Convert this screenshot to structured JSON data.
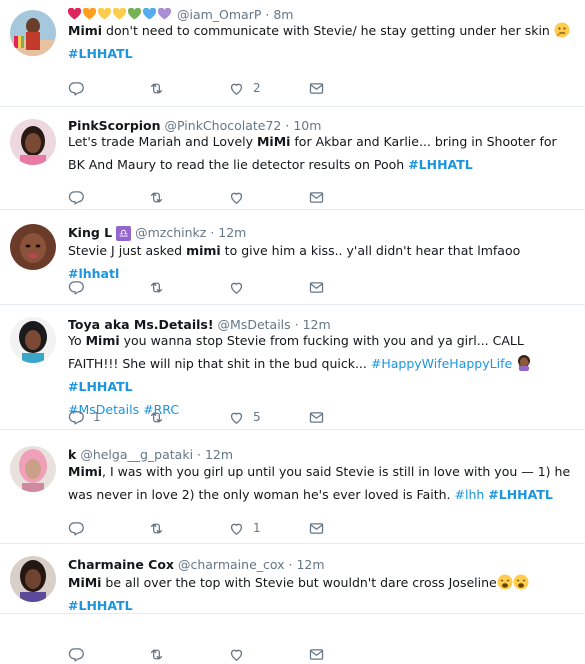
{
  "tweets": [
    {
      "avatar": "avatar-rainbow",
      "name_emoji": [
        "#e0245e",
        "#ff9f1c",
        "#ffcc4d",
        "#ffcc4d",
        "#77b255",
        "#55acee",
        "#aa8ed6"
      ],
      "name": "",
      "handle": "@iam_OmarP",
      "time": "8m",
      "parts": [
        {
          "t": "Mimi",
          "b": true
        },
        {
          "t": " don't need to communicate with Stevie/ he stay getting under her skin "
        },
        {
          "emoji": "thinking"
        },
        {
          "t": "\n"
        },
        {
          "t": "#LHHATL",
          "tag": true,
          "b": true
        }
      ],
      "reply": "",
      "retweet": "",
      "like": "2"
    },
    {
      "avatar": "avatar-pink",
      "name": "PinkScorpion",
      "handle": "@PinkChocolate72",
      "time": "10m",
      "parts": [
        {
          "t": "Let's trade Mariah and Lovely "
        },
        {
          "t": "MiMi",
          "b": true
        },
        {
          "t": " for Akbar and Karlie... bring in Shooter for BK And Maury to read the lie detector results on Pooh "
        },
        {
          "t": "#LHHATL",
          "tag": true,
          "b": true
        }
      ],
      "reply": "",
      "retweet": "",
      "like": ""
    },
    {
      "avatar": "avatar-kingl",
      "name": "King L",
      "name_badge": "♎",
      "handle": "@mzchinkz",
      "time": "12m",
      "parts": [
        {
          "t": "Stevie J just asked "
        },
        {
          "t": "mimi",
          "b": true
        },
        {
          "t": " to give him a kiss.. y'all didn't hear that lmfaoo "
        },
        {
          "t": "#lhhatl",
          "tag": true,
          "b": true
        }
      ],
      "reply": "",
      "retweet": "",
      "like": ""
    },
    {
      "avatar": "avatar-toya",
      "name": "Toya aka Ms.Details!",
      "handle": "@MsDetails",
      "time": "12m",
      "parts": [
        {
          "t": "Yo "
        },
        {
          "t": "Mimi",
          "b": true
        },
        {
          "t": " you wanna stop Stevie from fucking with you and ya girl... CALL FAITH!!! She will nip that shit in the bud quick... "
        },
        {
          "t": "#HappyWifeHappyLife",
          "tag": true
        },
        {
          "t": " "
        },
        {
          "emoji": "woman"
        },
        {
          "t": " "
        },
        {
          "t": "#LHHATL",
          "tag": true,
          "b": true
        },
        {
          "t": "\n"
        },
        {
          "t": "#MsDetails",
          "tag": true
        },
        {
          "t": " "
        },
        {
          "t": "#RRC",
          "tag": true
        }
      ],
      "reply": "1",
      "retweet": "",
      "like": "5"
    },
    {
      "avatar": "avatar-k",
      "name": "k",
      "handle": "@helga__g_pataki",
      "time": "12m",
      "parts": [
        {
          "t": "Mimi",
          "b": true
        },
        {
          "t": ", I was with you girl up until you said Stevie is still in love with you — 1) he was never in love 2) the only woman he's ever loved is Faith. "
        },
        {
          "t": "#lhh",
          "tag": true
        },
        {
          "t": " "
        },
        {
          "t": "#LHHATL",
          "tag": true,
          "b": true
        }
      ],
      "reply": "",
      "retweet": "",
      "like": "1"
    },
    {
      "avatar": "avatar-charmaine",
      "name": "Charmaine Cox",
      "handle": "@charmaine_cox",
      "time": "12m",
      "parts": [
        {
          "t": "MiMi",
          "b": true
        },
        {
          "t": " be all over the top with Stevie but wouldn't dare cross Joseline"
        },
        {
          "emoji": "weary"
        },
        {
          "emoji": "weary"
        },
        {
          "t": "\n"
        },
        {
          "t": "#LHHATL",
          "tag": true,
          "b": true
        }
      ],
      "reply": "",
      "retweet": "",
      "like": ""
    }
  ],
  "colors": {
    "accent": "#1b95e0",
    "muted": "#657786",
    "text": "#14171a",
    "divider": "#e6ecf0"
  }
}
